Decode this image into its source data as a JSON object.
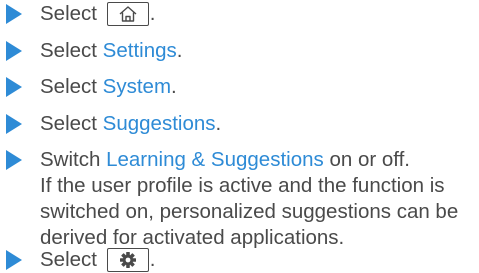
{
  "steps": [
    {
      "prefix": "Select",
      "key_icon": "home-icon",
      "suffix": "."
    },
    {
      "prefix": "Select ",
      "highlight": "Settings",
      "suffix": "."
    },
    {
      "prefix": "Select ",
      "highlight": "System",
      "suffix": "."
    },
    {
      "prefix": "Select ",
      "highlight": "Suggestions",
      "suffix": "."
    },
    {
      "prefix": "Switch ",
      "highlight": "Learning & Suggestions",
      "suffix": " on or off.",
      "lines": [
        "If the user profile is active and the function is",
        "switched on, personalized suggestions can be",
        "derived for activated applications."
      ]
    },
    {
      "prefix": "Select",
      "key_icon": "settings-icon",
      "suffix": "."
    }
  ],
  "colors": {
    "accent": "#2e8bd6",
    "text": "#4a4a4a"
  }
}
